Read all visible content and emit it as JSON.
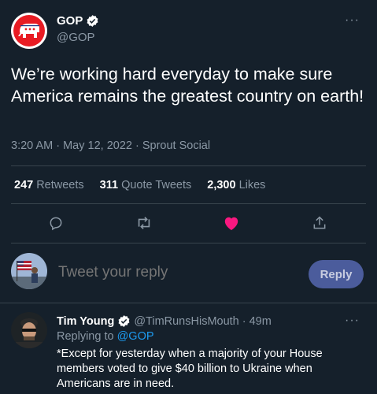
{
  "tweet": {
    "author_name": "GOP",
    "author_handle": "@GOP",
    "text": "We’re working hard everyday to make sure America remains the greatest country on earth!",
    "meta": "3:20 AM · May 12, 2022 · Sprout Social",
    "stats": {
      "retweets_count": "247",
      "retweets_label": "Retweets",
      "quotes_count": "311",
      "quotes_label": "Quote Tweets",
      "likes_count": "2,300",
      "likes_label": "Likes"
    },
    "more": "···"
  },
  "icons": [
    "reply-icon",
    "retweet-icon",
    "like-icon",
    "share-icon",
    "verified-icon",
    "more-icon"
  ],
  "colors": {
    "background": "#15202b",
    "like": "#f91880",
    "accent": "#1d9bf0",
    "reply_button": "#4b5c9c"
  },
  "reply_box": {
    "placeholder": "Tweet your reply",
    "button_label": "Reply"
  },
  "reply": {
    "author_name": "Tim Young",
    "author_handle": "@TimRunsHisMouth",
    "time": "· 49m",
    "replying_prefix": "Replying to",
    "replying_to": "@GOP",
    "text": "*Except for yesterday when a majority of your House members voted to give $40 billion to Ukraine when Americans are in need.",
    "more": "···"
  }
}
